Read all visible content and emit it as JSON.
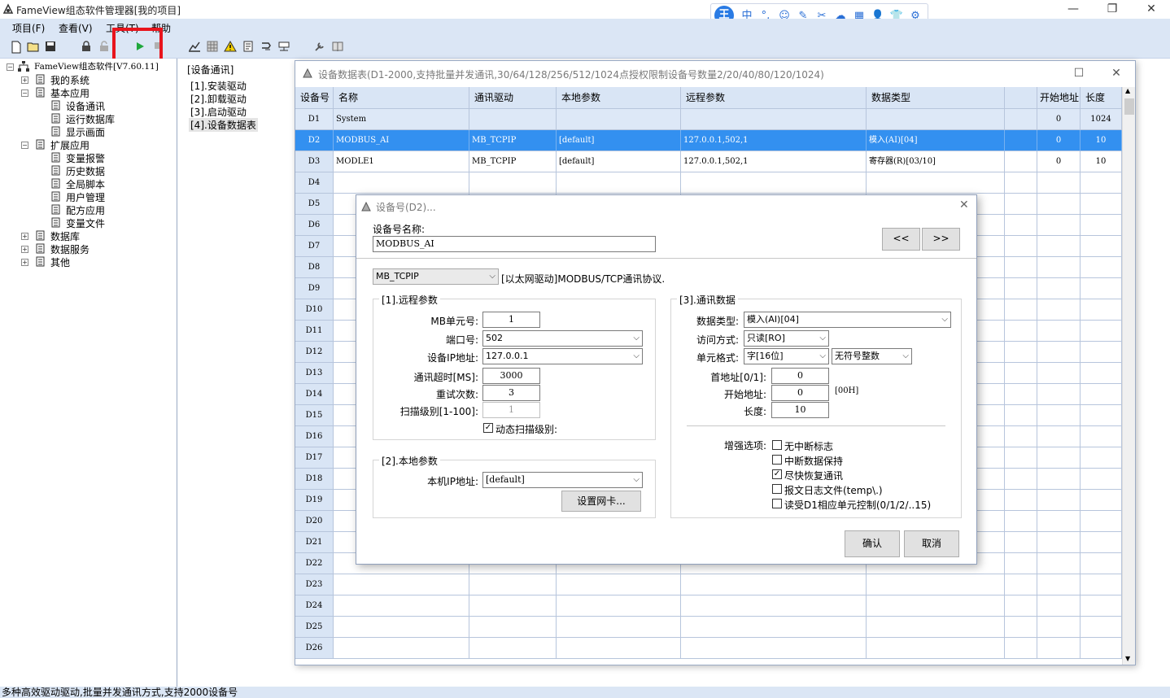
{
  "window": {
    "title": "FameView组态软件管理器[我的项目]",
    "min": "—",
    "max": "❐",
    "close": "✕"
  },
  "ime": {
    "logo": "王",
    "items": [
      "中",
      "°,",
      "☺",
      "✎",
      "✂",
      "☁",
      "▦",
      "👤",
      "👕",
      "⚙"
    ]
  },
  "menu": [
    "项目(F)",
    "查看(V)",
    "工具(T)",
    "帮助"
  ],
  "tree": {
    "root": "FameView组态软件[V7.60.11]",
    "items": [
      {
        "label": "我的系统",
        "level": 1,
        "exp": "+"
      },
      {
        "label": "基本应用",
        "level": 1,
        "exp": "-"
      },
      {
        "label": "设备通讯",
        "level": 2
      },
      {
        "label": "运行数据库",
        "level": 2
      },
      {
        "label": "显示画面",
        "level": 2
      },
      {
        "label": "扩展应用",
        "level": 1,
        "exp": "-"
      },
      {
        "label": "变量报警",
        "level": 2
      },
      {
        "label": "历史数据",
        "level": 2
      },
      {
        "label": "全局脚本",
        "level": 2
      },
      {
        "label": "用户管理",
        "level": 2
      },
      {
        "label": "配方应用",
        "level": 2
      },
      {
        "label": "变量文件",
        "level": 2
      },
      {
        "label": "数据库",
        "level": 1,
        "exp": "+"
      },
      {
        "label": "数据服务",
        "level": 1,
        "exp": "+"
      },
      {
        "label": "其他",
        "level": 1,
        "exp": "+"
      }
    ]
  },
  "mid": {
    "title": "[设备通讯]",
    "items": [
      "[1].安装驱动",
      "[2].卸载驱动",
      "[3].启动驱动",
      "[4].设备数据表"
    ]
  },
  "status": "多种高效驱动驱动,批量并发通讯方式,支持2000设备号",
  "table": {
    "title": "设备数据表(D1-2000,支持批量并发通讯,30/64/128/256/512/1024点授权限制设备号数量2/20/40/80/120/1024)",
    "headers": [
      "设备号",
      "名称",
      "通讯驱动",
      "本地参数",
      "远程参数",
      "数据类型",
      "",
      "开始地址",
      "长度"
    ],
    "rows": [
      [
        "D1",
        "System",
        "",
        "",
        "",
        "",
        "",
        "0",
        "1024"
      ],
      [
        "D2",
        "MODBUS_AI",
        "MB_TCPIP",
        "[default]",
        "127.0.0.1,502,1",
        "模入(AI)[04]",
        "",
        "0",
        "10"
      ],
      [
        "D3",
        "MODLE1",
        "MB_TCPIP",
        "[default]",
        "127.0.0.1,502,1",
        "寄存器(R)[03/10]",
        "",
        "0",
        "10"
      ]
    ],
    "row_ids": [
      "D4",
      "D5",
      "D6",
      "D7",
      "D8",
      "D9",
      "D10",
      "D11",
      "D12",
      "D13",
      "D14",
      "D15",
      "D16",
      "D17",
      "D18",
      "D19",
      "D20",
      "D21",
      "D22",
      "D23",
      "D24",
      "D25",
      "D26"
    ]
  },
  "dialog": {
    "title": "设备号(D2)...",
    "name_label": "设备号名称:",
    "name_value": "MODBUS_AI",
    "prev": "<<",
    "next": ">>",
    "driver": "MB_TCPIP",
    "driver_desc": "[以太网驱动]MODBUS/TCP通讯协议.",
    "g1": {
      "title": "[1].远程参数",
      "unit_label": "MB单元号:",
      "unit": "1",
      "port_label": "端口号:",
      "port": "502",
      "ip_label": "设备IP地址:",
      "ip": "127.0.0.1",
      "timeout_label": "通讯超时[MS]:",
      "timeout": "3000",
      "retry_label": "重试次数:",
      "retry": "3",
      "scan_label": "扫描级别[1-100]:",
      "scan": "1",
      "dyn_label": "动态扫描级别:"
    },
    "g2": {
      "title": "[2].本地参数",
      "local_ip_label": "本机IP地址:",
      "local_ip": "[default]",
      "nic_button": "设置网卡..."
    },
    "g3": {
      "title": "[3].通讯数据",
      "dtype_label": "数据类型:",
      "dtype": "模入(AI)[04]",
      "access_label": "访问方式:",
      "access": "只读[RO]",
      "fmt_label": "单元格式:",
      "fmt1": "字[16位]",
      "fmt2": "无符号整数",
      "first_label": "首地址[0/1]:",
      "first": "0",
      "start_label": "开始地址:",
      "start": "0",
      "start_hex": "[00H]",
      "len_label": "长度:",
      "len": "10",
      "enh_label": "增强选项:",
      "opts": [
        "无中断标志",
        "中断数据保持",
        "尽快恢复通讯",
        "报文日志文件(temp\\.)",
        "读受D1相应单元控制(0/1/2/..15)"
      ],
      "opts_checked": [
        false,
        false,
        true,
        false,
        false
      ]
    },
    "ok": "确认",
    "cancel": "取消"
  }
}
